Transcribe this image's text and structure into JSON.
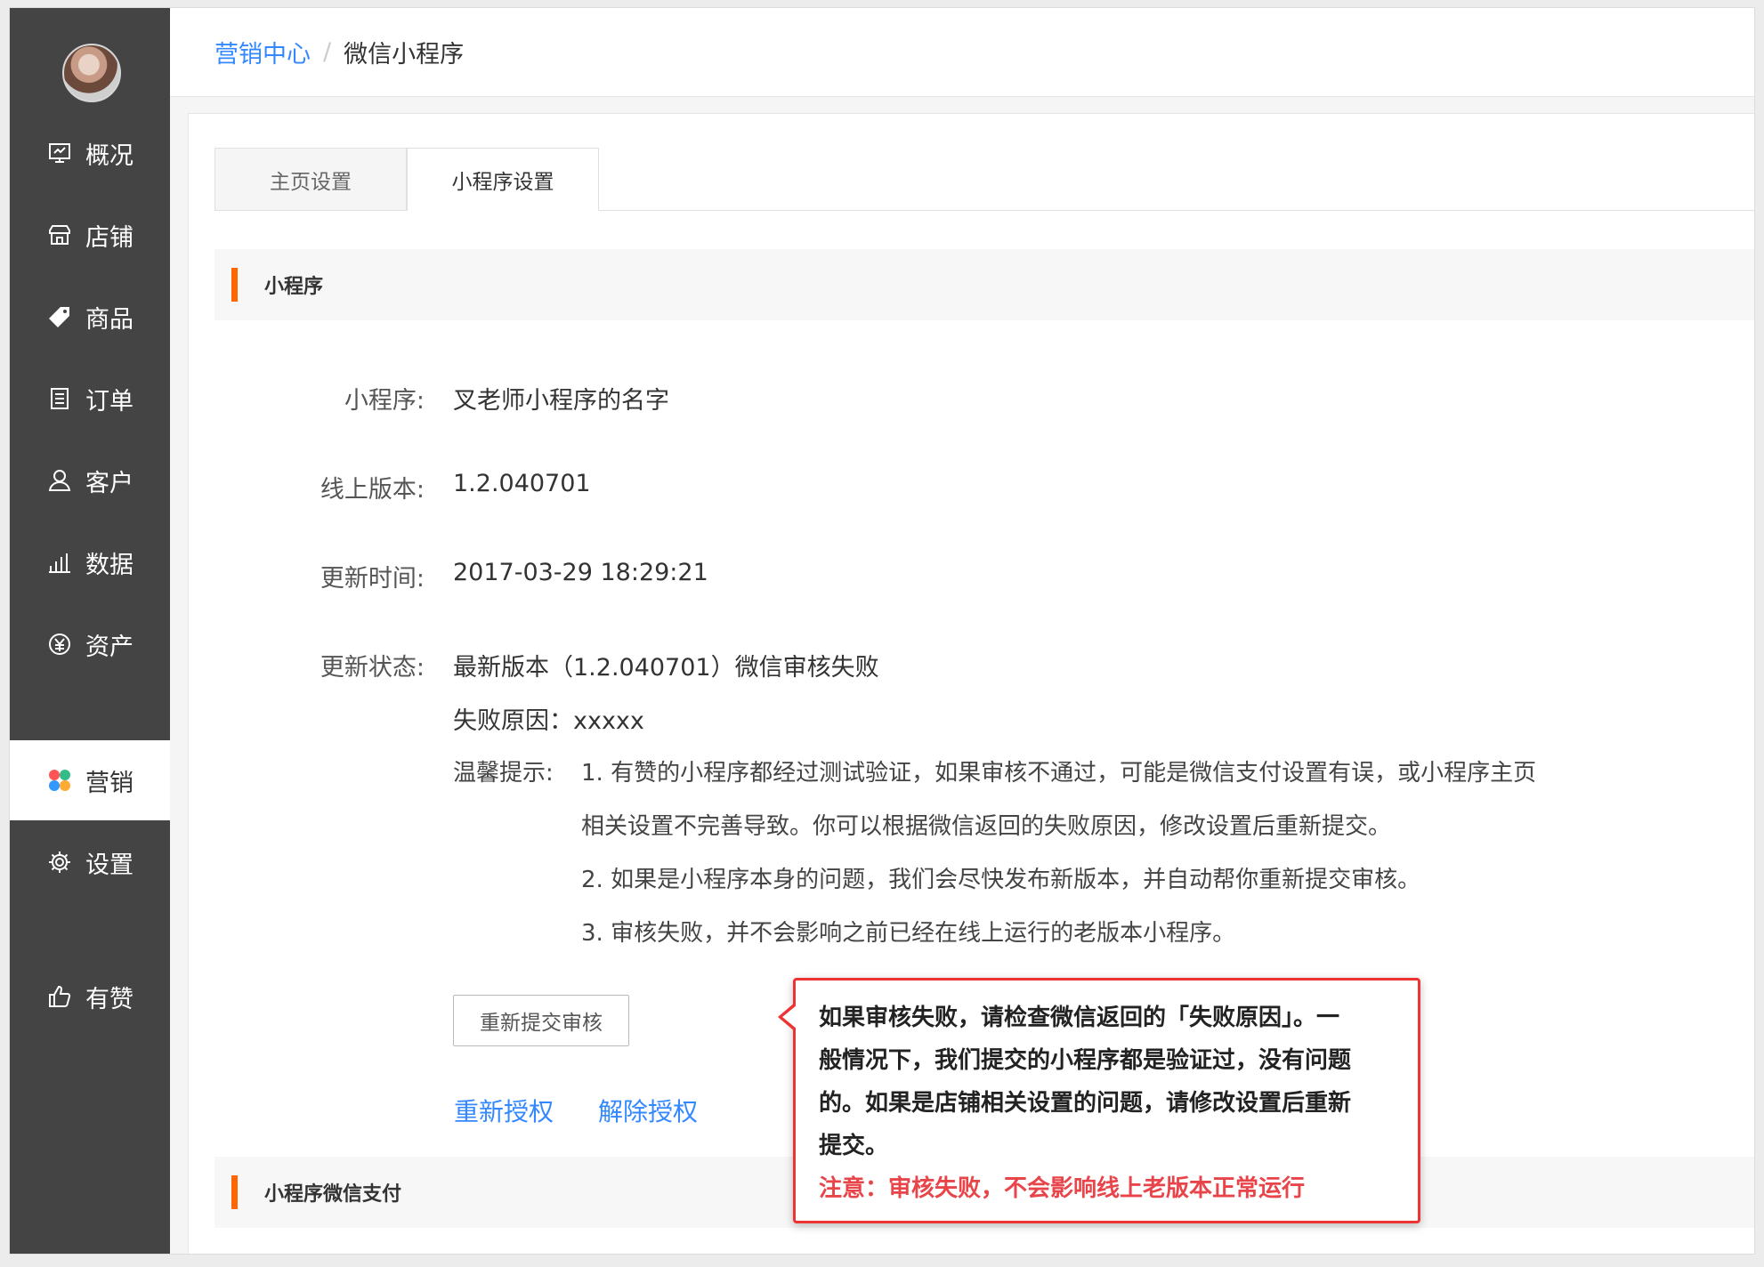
{
  "sidebar": {
    "items": [
      {
        "label": "概况",
        "icon": "overview-icon"
      },
      {
        "label": "店铺",
        "icon": "store-icon"
      },
      {
        "label": "商品",
        "icon": "tag-icon"
      },
      {
        "label": "订单",
        "icon": "order-list-icon"
      },
      {
        "label": "客户",
        "icon": "user-icon"
      },
      {
        "label": "数据",
        "icon": "bar-chart-icon"
      },
      {
        "label": "资产",
        "icon": "yuan-icon"
      },
      {
        "label": "营销",
        "icon": "marketing-clover-icon",
        "active": true
      },
      {
        "label": "设置",
        "icon": "gear-icon"
      },
      {
        "label": "有赞",
        "icon": "thumbs-up-icon"
      }
    ]
  },
  "breadcrumb": {
    "parent": "营销中心",
    "separator": "/",
    "current": "微信小程序"
  },
  "tabs": [
    {
      "label": "主页设置",
      "active": false
    },
    {
      "label": "小程序设置",
      "active": true
    }
  ],
  "section1": {
    "title": "小程序"
  },
  "details": {
    "name_label": "小程序:",
    "name_value": "叉老师小程序的名字",
    "version_label": "线上版本:",
    "version_value": "1.2.040701",
    "time_label": "更新时间:",
    "time_value": "2017-03-29 18:29:21",
    "status_label": "更新状态:",
    "status_value": "最新版本（1.2.040701）微信审核失败",
    "reason_text": "失败原因：xxxxx",
    "tips_label": "温馨提示:",
    "tips": [
      "1. 有赞的小程序都经过测试验证，如果审核不通过，可能是微信支付设置有误，或小程序主页",
      "相关设置不完善导致。你可以根据微信返回的失败原因，修改设置后重新提交。",
      "2. 如果是小程序本身的问题，我们会尽快发布新版本，并自动帮你重新提交审核。",
      "3. 审核失败，并不会影响之前已经在线上运行的老版本小程序。"
    ]
  },
  "actions": {
    "resubmit_button": "重新提交审核",
    "reauthorize_link": "重新授权",
    "revoke_link": "解除授权"
  },
  "section2": {
    "title": "小程序微信支付"
  },
  "callout": {
    "lines": [
      "如果审核失败，请检查微信返回的「失败原因」。一",
      "般情况下，我们提交的小程序都是验证过，没有问题",
      "的。如果是店铺相关设置的问题，请修改设置后重新",
      "提交。"
    ],
    "warning": "注意：审核失败，不会影响线上老版本正常运行"
  },
  "colors": {
    "sidebar_bg": "#444444",
    "link_blue": "#3388ff",
    "accent_orange": "#ff6600",
    "callout_red": "#e33333"
  }
}
